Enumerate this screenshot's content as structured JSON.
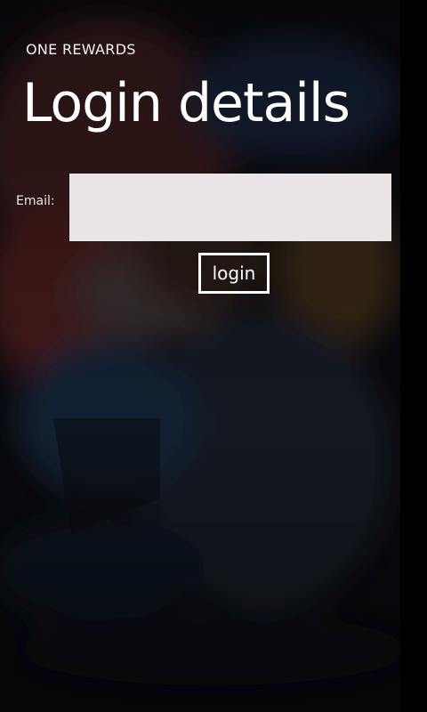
{
  "app": {
    "title": "ONE REWARDS"
  },
  "page": {
    "title": "Login details"
  },
  "form": {
    "email_label": "Email:",
    "email_value": "",
    "login_label": "login"
  }
}
